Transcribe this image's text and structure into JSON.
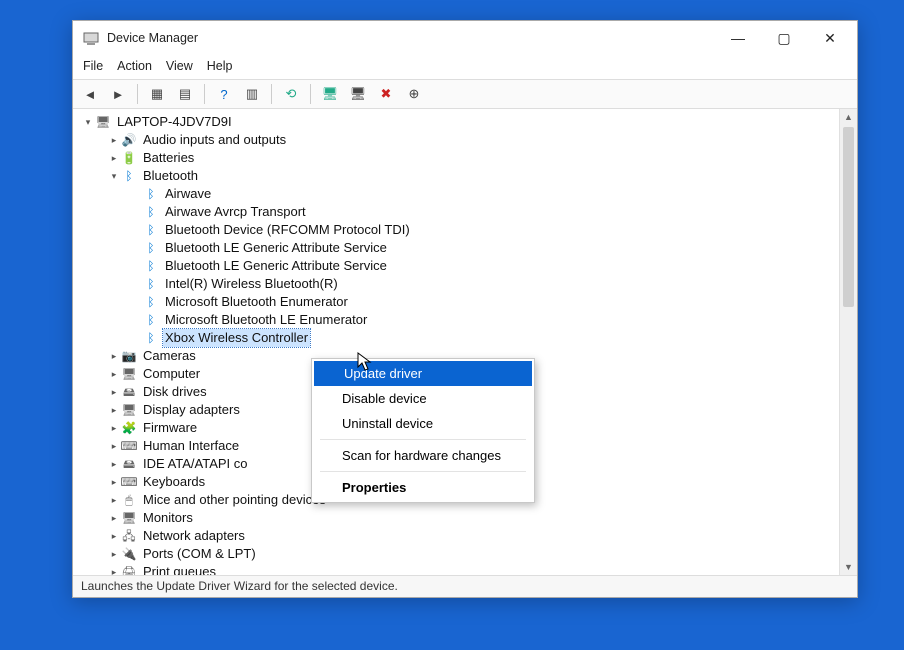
{
  "window": {
    "title": "Device Manager",
    "menus": [
      "File",
      "Action",
      "View",
      "Help"
    ]
  },
  "winbtns": {
    "min": "—",
    "max": "▢",
    "close": "✕"
  },
  "tree": {
    "root": "LAPTOP-4JDV7D9I",
    "items": [
      {
        "label": "Audio inputs and outputs",
        "icon": "🔊",
        "indent": 1,
        "exp": "▸"
      },
      {
        "label": "Batteries",
        "icon": "🔋",
        "indent": 1,
        "exp": "▸"
      },
      {
        "label": "Bluetooth",
        "icon": "ᛒ",
        "indent": 1,
        "exp": "▾",
        "bt": true
      },
      {
        "label": "Airwave",
        "icon": "ᛒ",
        "indent": 2,
        "bt": true
      },
      {
        "label": "Airwave Avrcp Transport",
        "icon": "ᛒ",
        "indent": 2,
        "bt": true
      },
      {
        "label": "Bluetooth Device (RFCOMM Protocol TDI)",
        "icon": "ᛒ",
        "indent": 2,
        "bt": true
      },
      {
        "label": "Bluetooth LE Generic Attribute Service",
        "icon": "ᛒ",
        "indent": 2,
        "bt": true
      },
      {
        "label": "Bluetooth LE Generic Attribute Service",
        "icon": "ᛒ",
        "indent": 2,
        "bt": true
      },
      {
        "label": "Intel(R) Wireless Bluetooth(R)",
        "icon": "ᛒ",
        "indent": 2,
        "bt": true
      },
      {
        "label": "Microsoft Bluetooth Enumerator",
        "icon": "ᛒ",
        "indent": 2,
        "bt": true
      },
      {
        "label": "Microsoft Bluetooth LE Enumerator",
        "icon": "ᛒ",
        "indent": 2,
        "bt": true
      },
      {
        "label": "Xbox Wireless Controller",
        "icon": "ᛒ",
        "indent": 2,
        "bt": true,
        "sel": true
      },
      {
        "label": "Cameras",
        "icon": "📷",
        "indent": 1,
        "exp": "▸"
      },
      {
        "label": "Computer",
        "icon": "🖥",
        "indent": 1,
        "exp": "▸"
      },
      {
        "label": "Disk drives",
        "icon": "🖴",
        "indent": 1,
        "exp": "▸"
      },
      {
        "label": "Display adapters",
        "icon": "🖥",
        "indent": 1,
        "exp": "▸"
      },
      {
        "label": "Firmware",
        "icon": "🧩",
        "indent": 1,
        "exp": "▸"
      },
      {
        "label": "Human Interface",
        "icon": "⌨",
        "indent": 1,
        "exp": "▸"
      },
      {
        "label": "IDE ATA/ATAPI co",
        "icon": "🖴",
        "indent": 1,
        "exp": "▸"
      },
      {
        "label": "Keyboards",
        "icon": "⌨",
        "indent": 1,
        "exp": "▸"
      },
      {
        "label": "Mice and other pointing devices",
        "icon": "🖱",
        "indent": 1,
        "exp": "▸"
      },
      {
        "label": "Monitors",
        "icon": "🖥",
        "indent": 1,
        "exp": "▸"
      },
      {
        "label": "Network adapters",
        "icon": "🖧",
        "indent": 1,
        "exp": "▸"
      },
      {
        "label": "Ports (COM & LPT)",
        "icon": "🔌",
        "indent": 1,
        "exp": "▸"
      },
      {
        "label": "Print queues",
        "icon": "🖨",
        "indent": 1,
        "exp": "▸"
      }
    ]
  },
  "context_menu": {
    "items": [
      {
        "label": "Update driver",
        "hl": true
      },
      {
        "label": "Disable device"
      },
      {
        "label": "Uninstall device"
      },
      {
        "sep": true
      },
      {
        "label": "Scan for hardware changes"
      },
      {
        "sep": true
      },
      {
        "label": "Properties",
        "bold": true
      }
    ]
  },
  "status": "Launches the Update Driver Wizard for the selected device."
}
